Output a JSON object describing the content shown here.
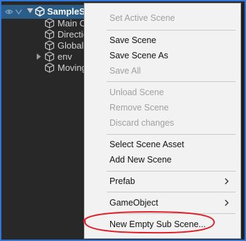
{
  "hierarchy": {
    "scene_name": "SampleSc",
    "items": [
      {
        "label": "Main C",
        "has_children": false
      },
      {
        "label": "Directio",
        "has_children": false
      },
      {
        "label": "Global",
        "has_children": false
      },
      {
        "label": "env",
        "has_children": true
      },
      {
        "label": "Moving",
        "has_children": false
      }
    ]
  },
  "context_menu": {
    "items": [
      {
        "label": "Set Active Scene",
        "enabled": false
      },
      {
        "label": "Save Scene",
        "enabled": true
      },
      {
        "label": "Save Scene As",
        "enabled": true
      },
      {
        "label": "Save All",
        "enabled": false
      },
      {
        "label": "Unload Scene",
        "enabled": false
      },
      {
        "label": "Remove Scene",
        "enabled": false
      },
      {
        "label": "Discard changes",
        "enabled": false
      },
      {
        "label": "Select Scene Asset",
        "enabled": true
      },
      {
        "label": "Add New Scene",
        "enabled": true
      },
      {
        "label": "Prefab",
        "enabled": true,
        "submenu": true
      },
      {
        "label": "GameObject",
        "enabled": true,
        "submenu": true
      },
      {
        "label": "New Empty Sub Scene...",
        "enabled": true,
        "highlighted_by_annotation": true
      }
    ]
  },
  "colors": {
    "panel_bg": "#282828",
    "selected_row": "#2c5d87",
    "menu_bg": "#f2f2f2",
    "annotation_red": "#e0202a",
    "frame_blue": "#2f78d8"
  }
}
